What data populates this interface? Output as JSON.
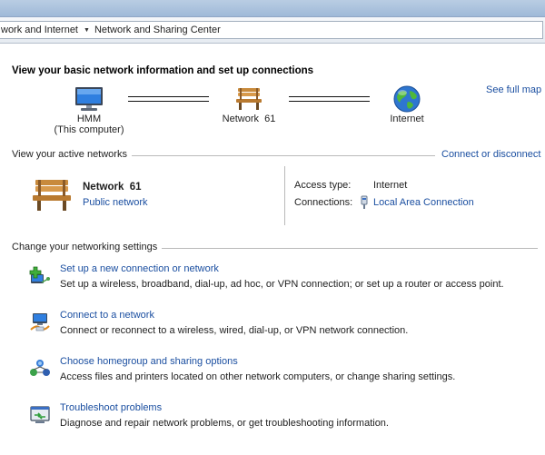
{
  "breadcrumb": {
    "items": [
      "work and Internet",
      "Network and Sharing Center"
    ]
  },
  "heading": "View your basic network information and set up connections",
  "see_full_map": "See full map",
  "map": {
    "computer": {
      "name": "HMM",
      "sub": "(This computer)"
    },
    "network": {
      "name": "Network  61"
    },
    "internet": {
      "name": "Internet"
    }
  },
  "active_networks": {
    "section_label": "View your active networks",
    "connect_link": "Connect or disconnect",
    "network_name": "Network  61",
    "network_type": "Public network",
    "access_type_label": "Access type:",
    "access_type_value": "Internet",
    "connections_label": "Connections:",
    "connections_value": "Local Area Connection"
  },
  "settings": {
    "section_label": "Change your networking settings",
    "tasks": [
      {
        "title": "Set up a new connection or network",
        "desc": "Set up a wireless, broadband, dial-up, ad hoc, or VPN connection; or set up a router or access point."
      },
      {
        "title": "Connect to a network",
        "desc": "Connect or reconnect to a wireless, wired, dial-up, or VPN network connection."
      },
      {
        "title": "Choose homegroup and sharing options",
        "desc": "Access files and printers located on other network computers, or change sharing settings."
      },
      {
        "title": "Troubleshoot problems",
        "desc": "Diagnose and repair network problems, or get troubleshooting information."
      }
    ]
  },
  "colors": {
    "link": "#1a4ea0",
    "title_bar": "#9fb9d8"
  }
}
